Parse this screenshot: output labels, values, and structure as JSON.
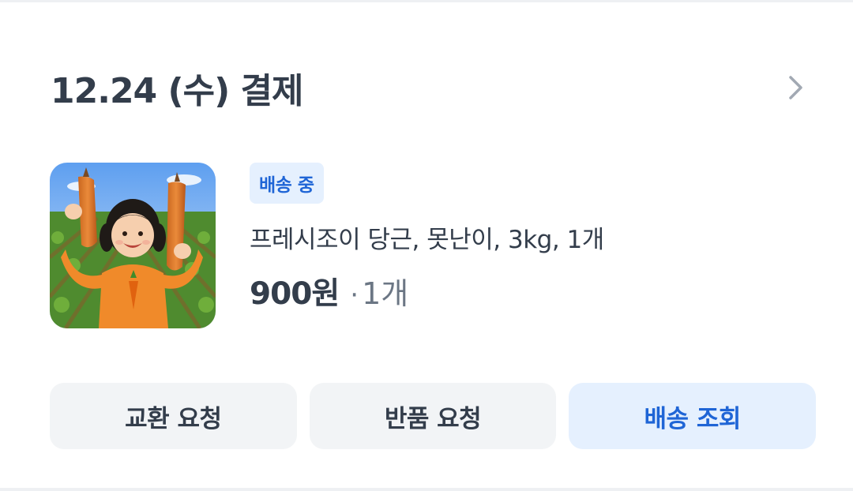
{
  "order": {
    "date_title": "12.24 (수) 결제"
  },
  "item": {
    "status_badge": "배송 중",
    "status_badge_color": "#1f65d6",
    "product_name": "프레시조이 당근, 못난이, 3kg, 1개",
    "price": "900원",
    "quantity_separator": "·",
    "quantity": "1개",
    "image_alt": "프레시조이 당근, 못난이, 3kg, 1개"
  },
  "actions": {
    "exchange": "교환 요청",
    "return": "반품 요청",
    "track": "배송 조회"
  },
  "icons": {
    "chevron": "chevron-right-icon"
  },
  "colors": {
    "text_primary": "#333d4b",
    "text_secondary": "#6b7684",
    "accent": "#1f65d6",
    "accent_bg": "#e5f0fe",
    "button_bg": "#f2f4f6"
  }
}
